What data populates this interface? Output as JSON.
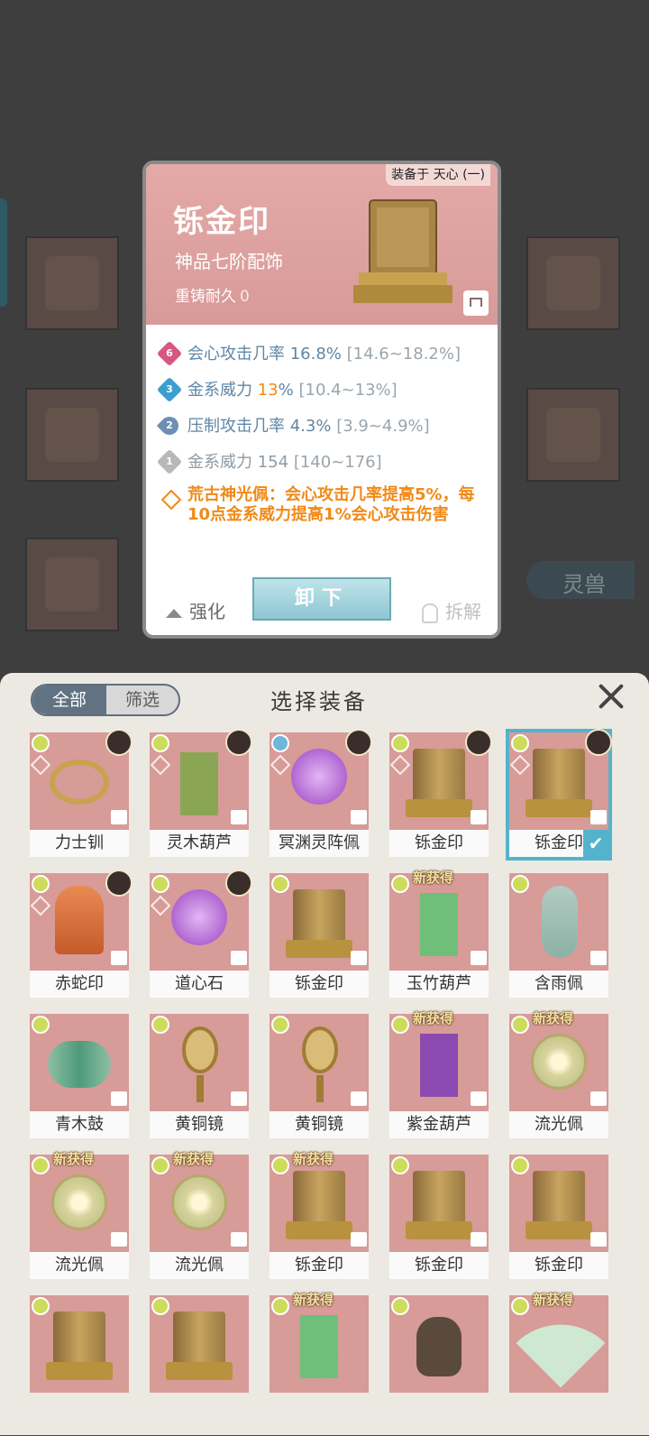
{
  "background": {
    "tab_label": "灵兽"
  },
  "card": {
    "equipped_on": "装备于 天心 (一)",
    "name": "铄金印",
    "quality": "神品七阶配饰",
    "reforge_label": "重铸耐久",
    "reforge_value": "0",
    "stats": [
      {
        "badge": "6",
        "badge_color": "#d6577f",
        "text": "会心攻击几率 16.8% ",
        "range": "[14.6~18.2%]"
      },
      {
        "badge": "3",
        "badge_color": "#3a9ed0",
        "text_pre": "金系威力 ",
        "highlight": "13",
        "text_post": "% ",
        "range": "[10.4~13%]"
      },
      {
        "badge": "2",
        "badge_color": "#6d8fb4",
        "text": "压制攻击几率 4.3% ",
        "range": "[3.9~4.9%]"
      },
      {
        "badge": "1",
        "badge_color": "#b8b8b8",
        "text": "金系威力 154 ",
        "range": "[140~176]"
      }
    ],
    "set_bonus": "荒古神光佩：会心攻击几率提高5%，每10点金系威力提高1%会心攻击伤害",
    "strengthen_label": "强化",
    "unequip_label": "卸下",
    "disassemble_label": "拆解"
  },
  "panel": {
    "tab_all": "全部",
    "tab_filter": "筛选",
    "title": "选择装备",
    "new_tag": "新获得",
    "items": [
      {
        "label": "力士钏",
        "shape": "ring",
        "color": "#c8a24e",
        "portrait": true
      },
      {
        "label": "灵木葫芦",
        "shape": "gourd",
        "color": "#8aa654",
        "portrait": true
      },
      {
        "label": "冥渊灵阵佩",
        "shape": "orb",
        "color": "#b66ad0",
        "portrait": true,
        "elem": "blue"
      },
      {
        "label": "铄金印",
        "shape": "seal",
        "color": "#b8923e",
        "portrait": true
      },
      {
        "label": "铄金印",
        "shape": "seal",
        "color": "#b8923e",
        "portrait": true,
        "selected": true
      },
      {
        "label": "赤蛇印",
        "shape": "coil",
        "color": "#d86a3a",
        "portrait": true
      },
      {
        "label": "道心石",
        "shape": "orb",
        "color": "#9a44c2",
        "portrait": true
      },
      {
        "label": "铄金印",
        "shape": "seal",
        "color": "#b8923e"
      },
      {
        "label": "玉竹葫芦",
        "shape": "gourd",
        "color": "#6fbf7a",
        "new": true
      },
      {
        "label": "含雨佩",
        "shape": "pendant",
        "color": "#a9d8cc"
      },
      {
        "label": "青木鼓",
        "shape": "drum",
        "color": "#4e9a7a"
      },
      {
        "label": "黄铜镜",
        "shape": "mirror",
        "color": "#d8bc78"
      },
      {
        "label": "黄铜镜",
        "shape": "mirror",
        "color": "#d8bc78"
      },
      {
        "label": "紫金葫芦",
        "shape": "gourd",
        "color": "#8a4ab0",
        "new": true
      },
      {
        "label": "流光佩",
        "shape": "disc",
        "color": "#d8d39c",
        "new": true
      },
      {
        "label": "流光佩",
        "shape": "disc",
        "color": "#d8d39c",
        "new": true
      },
      {
        "label": "流光佩",
        "shape": "disc",
        "color": "#d8d39c",
        "new": true
      },
      {
        "label": "铄金印",
        "shape": "seal",
        "color": "#b8923e",
        "new": true
      },
      {
        "label": "铄金印",
        "shape": "seal",
        "color": "#b8923e"
      },
      {
        "label": "铄金印",
        "shape": "seal",
        "color": "#b8923e"
      },
      {
        "label": "",
        "shape": "seal",
        "color": "#b8923e"
      },
      {
        "label": "",
        "shape": "seal",
        "color": "#b8923e"
      },
      {
        "label": "",
        "shape": "gourd",
        "color": "#6fbf7a",
        "new": true
      },
      {
        "label": "",
        "shape": "bag",
        "color": "#5a4a3e"
      },
      {
        "label": "",
        "shape": "fan",
        "color": "#cfe8d2",
        "new": true
      }
    ]
  },
  "colors": {
    "accent": "#54b3cc",
    "orange": "#f08a18",
    "card_pink": "#d79a98"
  }
}
